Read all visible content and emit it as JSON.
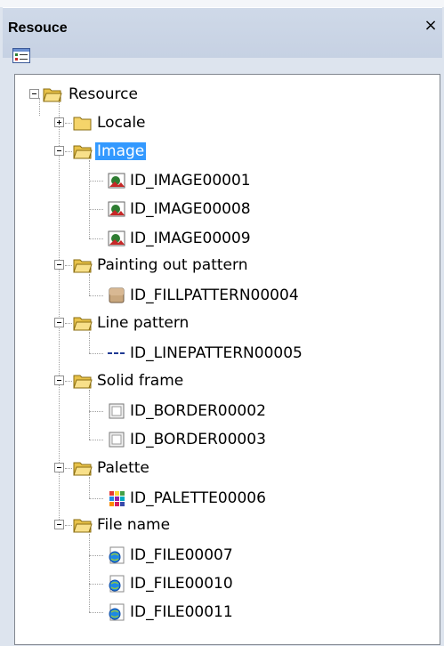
{
  "panel": {
    "title": "Resouce",
    "close_glyph": "×",
    "toolbar_icon": "properties-icon"
  },
  "tree": {
    "root": "Resource",
    "nodes": [
      {
        "label": "Locale",
        "state": "collapsed"
      },
      {
        "label": "Image",
        "state": "expanded",
        "selected": true,
        "children": [
          "ID_IMAGE00001",
          "ID_IMAGE00008",
          "ID_IMAGE00009"
        ]
      },
      {
        "label": "Painting out pattern",
        "state": "expanded",
        "children": [
          "ID_FILLPATTERN00004"
        ]
      },
      {
        "label": "Line pattern",
        "state": "expanded",
        "children": [
          "ID_LINEPATTERN00005"
        ]
      },
      {
        "label": "Solid frame",
        "state": "expanded",
        "children": [
          "ID_BORDER00002",
          "ID_BORDER00003"
        ]
      },
      {
        "label": "Palette",
        "state": "expanded",
        "children": [
          "ID_PALETTE00006"
        ]
      },
      {
        "label": "File name",
        "state": "expanded",
        "children": [
          "ID_FILE00007",
          "ID_FILE00010",
          "ID_FILE00011"
        ]
      }
    ]
  },
  "colors": {
    "selection": "#3399ff",
    "folder": "#f5d46a"
  }
}
